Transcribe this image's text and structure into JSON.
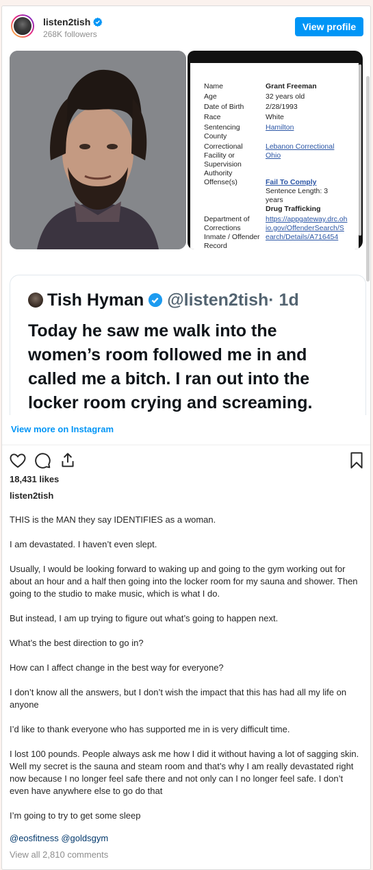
{
  "header": {
    "username": "listen2tish",
    "followers": "268K followers",
    "view_profile": "View profile"
  },
  "record": {
    "rows": [
      {
        "label": "Name",
        "value": "Grant Freeman"
      },
      {
        "label": "Age",
        "value": "32 years old"
      },
      {
        "label": "Date of Birth",
        "value": "2/28/1993"
      },
      {
        "label": "Race",
        "value": "White"
      },
      {
        "label": "Sentencing County",
        "value": "Hamilton"
      },
      {
        "label": "Correctional Facility or Supervision Authority",
        "value": "Lebanon Correctional Ohio"
      },
      {
        "label": "Offense(s)",
        "value": "Fail To Comply"
      },
      {
        "label": "",
        "value": "Sentence Length: 3 years"
      },
      {
        "label": "",
        "value": "Drug Trafficking"
      },
      {
        "label": "Department of Corrections Inmate / Offender Record",
        "value": "https://appgateway.drc.ohio.gov/OffenderSearch/Search/Details/A716454"
      }
    ]
  },
  "tweet": {
    "name": "Tish Hyman",
    "handle": "@listen2tish",
    "time": "· 1d",
    "text": "Today he saw me walk into the women’s room followed me in and called me a bitch. I ran out into the locker room crying and screaming. This is why we can’t have nice"
  },
  "view_more": "View more on Instagram",
  "likes": "18,431 likes",
  "caption": {
    "username": "listen2tish",
    "paragraphs": [
      "THIS is the MAN they say IDENTIFIES as a woman.",
      "I am devastated. I haven’t even slept.",
      "Usually, I would be looking forward to waking up and going to the gym working out for about an hour and a half then going into the locker room for my sauna and shower. Then going to the studio to make music, which is what I do.",
      "But instead, I am up trying to figure out what’s going to happen next.",
      "What’s the best direction to go in?",
      "How can I affect change in the best way for everyone?",
      "I don’t know all the answers, but I don’t wish the impact that this has had all my life on anyone",
      "I’d like to thank everyone who has supported me in is very difficult time.",
      "I lost 100 pounds. People always ask me how I did it without having a lot of sagging skin. Well my secret is the sauna and steam room and that’s why I am really devastated right now because I no longer feel safe there and not only can I no longer feel safe. I don’t even have anywhere else to go do that",
      "I’m going to try to get some sleep"
    ],
    "mentions": "@eosfitness @goldsgym"
  },
  "view_comments": "View all 2,810 comments"
}
